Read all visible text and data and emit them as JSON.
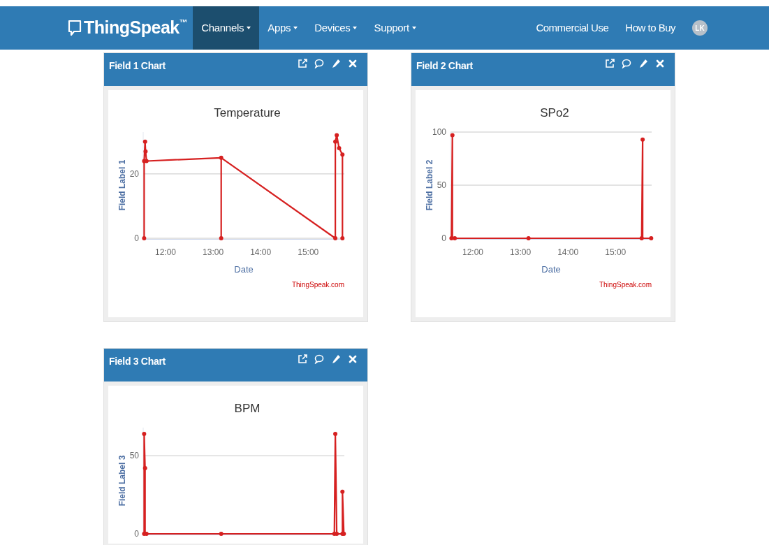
{
  "navbar": {
    "brand": "ThingSpeak",
    "brand_mark": "™",
    "menus": [
      {
        "label": "Channels",
        "selected": true
      },
      {
        "label": "Apps",
        "selected": false
      },
      {
        "label": "Devices",
        "selected": false
      },
      {
        "label": "Support",
        "selected": false
      }
    ],
    "links": [
      "Commercial Use",
      "How to Buy"
    ],
    "avatar": "LK"
  },
  "cards": [
    {
      "title": "Field 1 Chart",
      "credit": "ThingSpeak.com",
      "chart_data": {
        "type": "line",
        "title": "Temperature",
        "xlabel": "Date",
        "ylabel": "Field Label 1",
        "x": [
          11.55,
          11.55,
          11.57,
          11.58,
          11.6,
          13.17,
          13.17,
          13.17,
          15.57,
          15.57,
          15.6,
          15.65,
          15.72,
          15.72
        ],
        "series": [
          {
            "color": "#d62020",
            "marker": "circle",
            "values": [
              0,
              24,
              30,
              27,
              24,
              25,
              0,
              25,
              0,
              30,
              32,
              28,
              26,
              0
            ]
          }
        ],
        "xlim": [
          11.53,
          15.76
        ],
        "ylim": [
          0,
          33
        ],
        "xticks": [
          {
            "value": 12,
            "label": "12:00"
          },
          {
            "value": 13,
            "label": "13:00"
          },
          {
            "value": 14,
            "label": "14:00"
          },
          {
            "value": 15,
            "label": "15:00"
          }
        ],
        "yticks": [
          0,
          20
        ]
      }
    },
    {
      "title": "Field 2 Chart",
      "credit": "ThingSpeak.com",
      "chart_data": {
        "type": "line",
        "title": "SPo2",
        "xlabel": "Date",
        "ylabel": "Field Label 2",
        "x": [
          11.55,
          11.57,
          11.57,
          11.62,
          13.17,
          15.55,
          15.57,
          15.57,
          15.75
        ],
        "series": [
          {
            "color": "#d62020",
            "marker": "circle",
            "values": [
              0,
              97,
              0,
              0,
              0,
              0,
              93,
              0,
              0
            ]
          }
        ],
        "xlim": [
          11.53,
          15.76
        ],
        "ylim": [
          0,
          100
        ],
        "xticks": [
          {
            "value": 12,
            "label": "12:00"
          },
          {
            "value": 13,
            "label": "13:00"
          },
          {
            "value": 14,
            "label": "14:00"
          },
          {
            "value": 15,
            "label": "15:00"
          }
        ],
        "yticks": [
          0,
          50,
          100
        ]
      }
    },
    {
      "title": "Field 3 Chart",
      "chart_data": {
        "type": "line",
        "title": "BPM",
        "ylabel": "Field Label 3",
        "x": [
          11.55,
          11.55,
          11.57,
          11.57,
          11.6,
          13.17,
          15.55,
          15.57,
          15.6,
          15.72,
          15.72,
          15.75
        ],
        "series": [
          {
            "color": "#d62020",
            "marker": "circle",
            "values": [
              0,
              64,
              42,
              0,
              0,
              0,
              0,
              64,
              0,
              0,
              27,
              0
            ]
          }
        ],
        "xlim": [
          11.53,
          15.76
        ],
        "ylim": [
          0,
          68
        ],
        "yticks": [
          0,
          50
        ]
      }
    }
  ]
}
